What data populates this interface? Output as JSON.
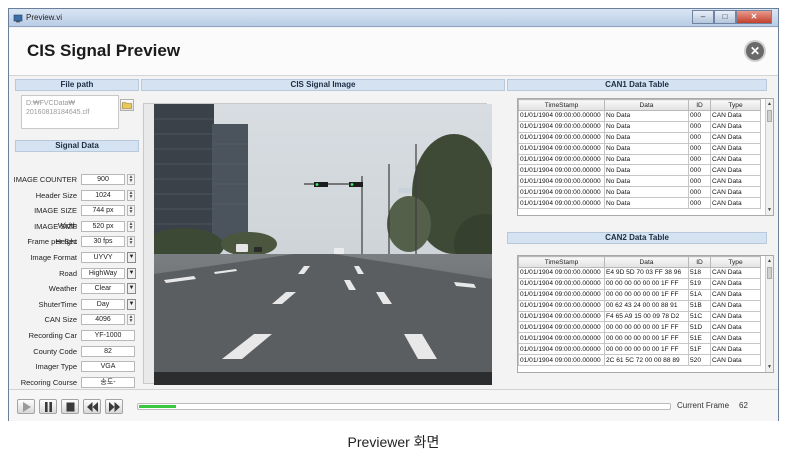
{
  "window": {
    "title": "Preview.vi",
    "min_label": "–",
    "max_label": "□",
    "close_label": "✕"
  },
  "header": {
    "title": "CIS Signal Preview",
    "close_glyph": "✕"
  },
  "panels": {
    "file_path_title": "File path",
    "signal_data_title": "Signal Data",
    "image_title": "CIS Signal Image",
    "can1_title": "CAN1 Data Table",
    "can2_title": "CAN2 Data Table"
  },
  "file_path": {
    "line1": "D:₩FVCData₩",
    "line2": "20160818184645.clf",
    "folder_icon": "folder-icon"
  },
  "signal_data": [
    {
      "label": "IMAGE COUNTER",
      "value": "900",
      "control": "spin"
    },
    {
      "label": "Header Size",
      "value": "1024",
      "control": "spin"
    },
    {
      "label": "IMAGE SIZE Width",
      "value": "744 px",
      "control": "spin"
    },
    {
      "label": "IMAGE SIZE Height",
      "value": "520 px",
      "control": "spin"
    },
    {
      "label": "Frame per Sec",
      "value": "30 fps",
      "control": "spin"
    },
    {
      "label": "Image Format",
      "value": "UYVY",
      "control": "drop"
    },
    {
      "label": "Road",
      "value": "HighWay",
      "control": "drop"
    },
    {
      "label": "Weather",
      "value": "Clear",
      "control": "drop"
    },
    {
      "label": "ShuterTime",
      "value": "Day",
      "control": "drop"
    },
    {
      "label": "CAN Size",
      "value": "4096",
      "control": "spin"
    },
    {
      "label": "Recording Car",
      "value": "YF-1000",
      "control": "none"
    },
    {
      "label": "County  Code",
      "value": "82",
      "control": "none"
    },
    {
      "label": "Imager Type",
      "value": "VGA",
      "control": "none"
    },
    {
      "label": "Recoring Course",
      "value": "송도-",
      "control": "none"
    }
  ],
  "can_columns": [
    "TimeStamp",
    "Data",
    "ID",
    "Type"
  ],
  "can1_rows": [
    [
      "01/01/1904 09:00:00.00000",
      "No Data",
      "000",
      "CAN Data"
    ],
    [
      "01/01/1904 09:00:00.00000",
      "No Data",
      "000",
      "CAN Data"
    ],
    [
      "01/01/1904 09:00:00.00000",
      "No Data",
      "000",
      "CAN Data"
    ],
    [
      "01/01/1904 09:00:00.00000",
      "No Data",
      "000",
      "CAN Data"
    ],
    [
      "01/01/1904 09:00:00.00000",
      "No Data",
      "000",
      "CAN Data"
    ],
    [
      "01/01/1904 09:00:00.00000",
      "No Data",
      "000",
      "CAN Data"
    ],
    [
      "01/01/1904 09:00:00.00000",
      "No Data",
      "000",
      "CAN Data"
    ],
    [
      "01/01/1904 09:00:00.00000",
      "No Data",
      "000",
      "CAN Data"
    ],
    [
      "01/01/1904 09:00:00.00000",
      "No Data",
      "000",
      "CAN Data"
    ]
  ],
  "can2_rows": [
    [
      "01/01/1904 09:00:00.00000",
      "E4 9D 5D 70 03 FF 38 96",
      "518",
      "CAN Data"
    ],
    [
      "01/01/1904 09:00:00.00000",
      "00 00 00 00 00 00 1F FF",
      "519",
      "CAN Data"
    ],
    [
      "01/01/1904 09:00:00.00000",
      "00 00 00 00 00 00 1F FF",
      "51A",
      "CAN Data"
    ],
    [
      "01/01/1904 09:00:00.00000",
      "00 62 43 24 00 00 88 91",
      "51B",
      "CAN Data"
    ],
    [
      "01/01/1904 09:00:00.00000",
      "F4 65 A9 15 00 09 78 D2",
      "51C",
      "CAN Data"
    ],
    [
      "01/01/1904 09:00:00.00000",
      "00 00 00 00 00 00 1F FF",
      "51D",
      "CAN Data"
    ],
    [
      "01/01/1904 09:00:00.00000",
      "00 00 00 00 00 00 1F FF",
      "51E",
      "CAN Data"
    ],
    [
      "01/01/1904 09:00:00.00000",
      "00 00 00 00 00 00 1F FF",
      "51F",
      "CAN Data"
    ],
    [
      "01/01/1904 09:00:00.00000",
      "2C 61 5C 72 00 00 88 89",
      "520",
      "CAN Data"
    ]
  ],
  "player": {
    "buttons": [
      "play-icon",
      "pause-icon",
      "stop-icon",
      "rewind-icon",
      "fast-forward-icon"
    ],
    "progress_fraction": 0.07,
    "progress_color": "#39c83f",
    "frame_label": "Current Frame",
    "frame_value": "62"
  },
  "caption": "Previewer 화면"
}
